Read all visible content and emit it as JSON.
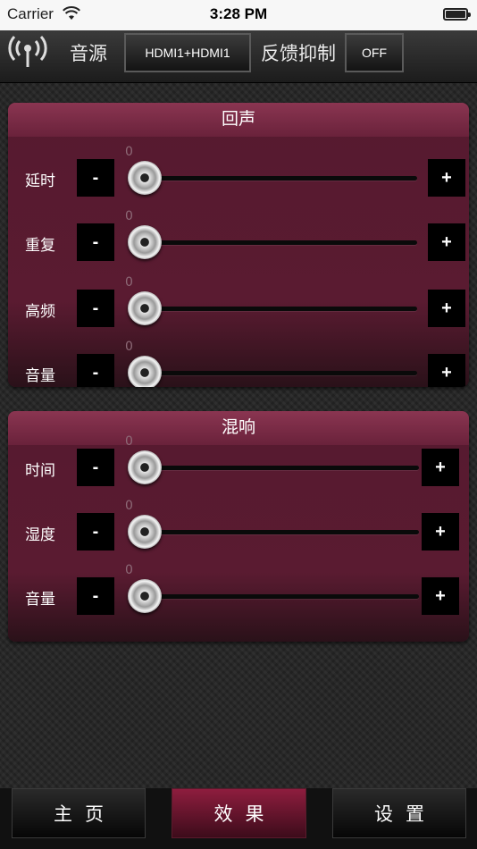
{
  "status_bar": {
    "carrier": "Carrier",
    "time": "3:28 PM"
  },
  "toolbar": {
    "source_label": "音源",
    "source_value": "HDMI1+HDMI1",
    "feedback_label": "反馈抑制",
    "feedback_value": "OFF"
  },
  "echo": {
    "title": "回声",
    "rows": [
      {
        "label": "延时",
        "value": "0",
        "minus": "-",
        "plus": "+"
      },
      {
        "label": "重复",
        "value": "0",
        "minus": "-",
        "plus": "+"
      },
      {
        "label": "高频",
        "value": "0",
        "minus": "-",
        "plus": "+"
      },
      {
        "label": "音量",
        "value": "0",
        "minus": "-",
        "plus": "+"
      }
    ]
  },
  "reverb": {
    "title": "混响",
    "rows": [
      {
        "label": "时间",
        "value": "0",
        "minus": "-",
        "plus": "+"
      },
      {
        "label": "湿度",
        "value": "0",
        "minus": "-",
        "plus": "+"
      },
      {
        "label": "音量",
        "value": "0",
        "minus": "-",
        "plus": "+"
      }
    ]
  },
  "tabs": [
    {
      "label": "主页",
      "active": false
    },
    {
      "label": "效果",
      "active": true
    },
    {
      "label": "设置",
      "active": false
    }
  ],
  "colors": {
    "panel": "#5a1b31",
    "panel_header": "#7a2a45",
    "active_tab": "#8e1d3e"
  },
  "icons": {
    "toolbar": "signal-broadcast-icon",
    "wifi": "wifi-icon",
    "battery": "battery-icon"
  }
}
